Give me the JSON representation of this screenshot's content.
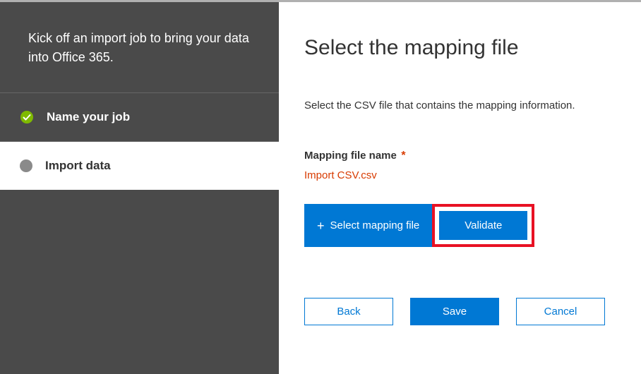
{
  "sidebar": {
    "intro": "Kick off an import job to bring your data into Office 365.",
    "steps": [
      {
        "label": "Name your job",
        "state": "completed"
      },
      {
        "label": "Import data",
        "state": "current"
      }
    ]
  },
  "main": {
    "title": "Select the mapping file",
    "description": "Select the CSV file that contains the mapping information.",
    "field_label": "Mapping file name",
    "required_mark": "*",
    "file_name": "Import CSV.csv",
    "select_file_button": "Select mapping file",
    "validate_button": "Validate"
  },
  "footer": {
    "back": "Back",
    "save": "Save",
    "cancel": "Cancel"
  }
}
